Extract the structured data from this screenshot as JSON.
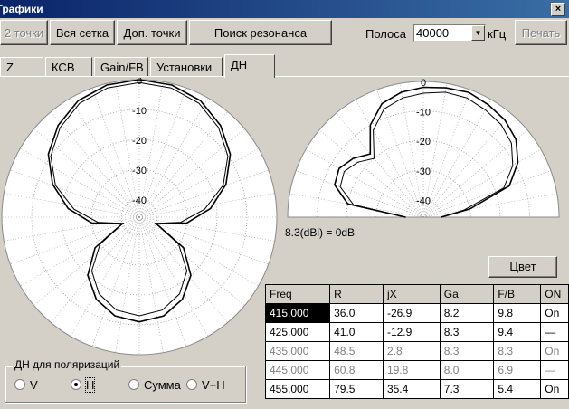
{
  "window": {
    "title": "Графики",
    "close_glyph": "×"
  },
  "toolbar": {
    "buttons": [
      {
        "label": "2 точки",
        "disabled": true
      },
      {
        "label": "Вся сетка",
        "disabled": false
      },
      {
        "label": "Доп. точки",
        "disabled": false
      },
      {
        "label": "Поиск резонанса",
        "disabled": false
      }
    ],
    "band_label": "Полоса",
    "band_value": "40000",
    "band_unit": "кГц",
    "print_label": "Печать"
  },
  "tabs": [
    {
      "label": "Z",
      "active": false
    },
    {
      "label": "КСВ",
      "active": false
    },
    {
      "label": "Gain/FB",
      "active": false
    },
    {
      "label": "Установки",
      "active": false
    },
    {
      "label": "ДН",
      "active": true
    }
  ],
  "chart_data": [
    {
      "type": "polar",
      "name": "azimuth",
      "rings_db": [
        0,
        -10,
        -20,
        -30,
        -40
      ],
      "ring_labels": [
        "0",
        "-10",
        "-20",
        "-30",
        "-40"
      ],
      "series": [
        {
          "values_db": [
            0,
            -0.5,
            -2,
            -5,
            -9,
            -15,
            -22,
            -30,
            -40,
            -28,
            -20,
            -15,
            -12,
            -11,
            -12,
            -15,
            -20,
            -28,
            -40,
            -30,
            -22,
            -15,
            -9,
            -5,
            -2,
            -0.5
          ]
        },
        {
          "values_db": [
            -1,
            -1.5,
            -3,
            -6,
            -10,
            -16,
            -24,
            -32,
            -40,
            -30,
            -22,
            -17,
            -14,
            -13,
            -14,
            -17,
            -22,
            -30,
            -40,
            -32,
            -24,
            -16,
            -10,
            -6,
            -3,
            -1.5
          ]
        }
      ]
    },
    {
      "type": "polar",
      "name": "elevation",
      "rings_db": [
        0,
        -10,
        -20,
        -30,
        -40
      ],
      "ring_labels": [
        "0",
        "-10",
        "-20",
        "-30",
        "-40"
      ],
      "series": [
        {
          "values_db": [
            -40,
            -20,
            -14,
            -13,
            -15,
            -18,
            -10,
            -5,
            -3,
            -2,
            -1.5,
            -1,
            -2,
            -3,
            -5,
            -9,
            -15,
            -30,
            -40
          ]
        },
        {
          "values_db": [
            -40,
            -22,
            -16,
            -15,
            -17,
            -20,
            -12,
            -7,
            -5,
            -4,
            -3,
            -3,
            -4,
            -5,
            -7,
            -11,
            -17,
            -32,
            -40
          ]
        }
      ],
      "gain_note": "8.3(dBi) = 0dB"
    }
  ],
  "color_button": "Цвет",
  "table": {
    "headers": [
      "Freq",
      "R",
      "jX",
      "Ga",
      "F/B",
      "ON"
    ],
    "rows": [
      {
        "cells": [
          "415.000",
          "36.0",
          "-26.9",
          "8.2",
          "9.8",
          "On"
        ],
        "dim": false,
        "selected": true
      },
      {
        "cells": [
          "425.000",
          "41.0",
          "-12.9",
          "8.3",
          "9.4",
          "—"
        ],
        "dim": false,
        "selected": false
      },
      {
        "cells": [
          "435.000",
          "48.5",
          "2.8",
          "8.3",
          "8.3",
          "On"
        ],
        "dim": true,
        "selected": false
      },
      {
        "cells": [
          "445.000",
          "60.8",
          "19.8",
          "8.0",
          "6.9",
          "—"
        ],
        "dim": true,
        "selected": false
      },
      {
        "cells": [
          "455.000",
          "79.5",
          "35.4",
          "7.3",
          "5.4",
          "On"
        ],
        "dim": false,
        "selected": false
      }
    ]
  },
  "polarization": {
    "legend": "ДН для поляризаций",
    "options": [
      {
        "label": "V",
        "checked": false
      },
      {
        "label": "H",
        "checked": true
      },
      {
        "label": "Сумма",
        "checked": false
      },
      {
        "label": "V+H",
        "checked": false
      }
    ]
  }
}
